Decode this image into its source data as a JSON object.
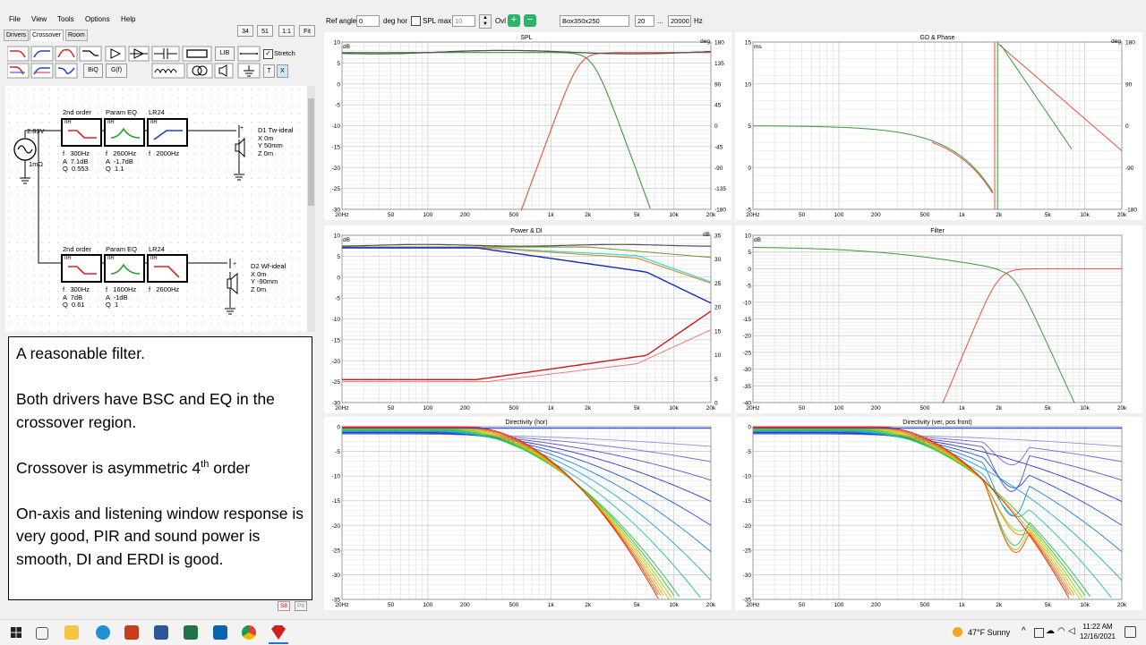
{
  "menu": [
    "File",
    "View",
    "Tools",
    "Options",
    "Help"
  ],
  "tabs": [
    "Drivers",
    "Crossover",
    "Room"
  ],
  "toolbar": {
    "buttons": [
      "34",
      "51",
      "1:1",
      "Fit"
    ],
    "biq": "BiQ",
    "gf": "G(f)",
    "lib": "LIB",
    "stretch_label": "Stretch",
    "stretch_checked": true,
    "t": "T",
    "x": "X"
  },
  "schematic": {
    "source_voltage": "2.83V",
    "source_impedance": "1mΩ",
    "row1": {
      "headers": [
        "2nd order",
        "Param EQ",
        "LR24"
      ],
      "blocks": [
        {
          "type": "IIR",
          "params": "f   300Hz\nA  7.1dB\nQ  0.553"
        },
        {
          "type": "IIR",
          "params": "f   2600Hz\nA  -1.7dB\nQ  1.1"
        },
        {
          "type": "IIR",
          "params": "f   2000Hz"
        }
      ],
      "driver": "D1 Tw-ideal\nX 0m\nY 50mm\nZ 0m"
    },
    "row2": {
      "headers": [
        "2nd order",
        "Param EQ",
        "LR24"
      ],
      "blocks": [
        {
          "type": "IIR",
          "params": "f   300Hz\nA  7dB\nQ  0.61"
        },
        {
          "type": "IIR",
          "params": "f   1600Hz\nA  -1dB\nQ  1"
        },
        {
          "type": "IIR",
          "params": "f   2600Hz"
        }
      ],
      "driver": "D2 Wf-ideal\nX 0m\nY -90mm\nZ 0m"
    },
    "plus": "+",
    "minus": "-"
  },
  "notes": {
    "p1": "A reasonable filter.",
    "p2": "Both drivers have BSC and EQ in the crossover region.",
    "p3_pre": "Crossover is asymmetric 4",
    "p3_sup": "th",
    "p3_post": " order",
    "p4": "On-axis and listening window response is very good, PIR and sound power is smooth, DI and ERDI is good."
  },
  "status_buttons": [
    "S8",
    "P8"
  ],
  "graph_bar": {
    "ref_angle_label": "Ref angle",
    "ref_angle_value": "0",
    "deg_hor": "deg hor",
    "spl_max_label": "SPL max",
    "spl_max_value": "10",
    "ovl_label": "Ovl",
    "baffle": "Box350x250",
    "f_low": "20",
    "dots": "...",
    "f_high": "20000",
    "hz": "Hz"
  },
  "x_ticks": [
    "20Hz",
    "50",
    "100",
    "200",
    "500",
    "1k",
    "2k",
    "5k",
    "10k",
    "20k"
  ],
  "x_tick_freqs": [
    20,
    50,
    100,
    200,
    500,
    1000,
    2000,
    5000,
    10000,
    20000
  ],
  "plots": [
    {
      "id": "spl",
      "title": "SPL",
      "unit_left": "dB",
      "unit_right": "deg",
      "y_left": [
        "10",
        "5",
        "0",
        "-5",
        "-10",
        "-15",
        "-20",
        "-25",
        "-30"
      ],
      "y_right": [
        "180",
        "135",
        "90",
        "45",
        "0",
        "-45",
        "-90",
        "-135",
        "-180"
      ]
    },
    {
      "id": "gd",
      "title": "GD & Phase",
      "unit_left": "ms",
      "unit_right": "deg",
      "y_left": [
        "15",
        "10",
        "5",
        "0",
        "-5"
      ],
      "y_right": [
        "180",
        "90",
        "0",
        "-90",
        "-180"
      ]
    },
    {
      "id": "power",
      "title": "Power & DI",
      "unit_left": "dB",
      "unit_right": "dB",
      "y_left": [
        "10",
        "5",
        "0",
        "-5",
        "-10",
        "-15",
        "-20",
        "-25",
        "-30"
      ],
      "y_right": [
        "35",
        "30",
        "25",
        "20",
        "15",
        "10",
        "5",
        "0"
      ]
    },
    {
      "id": "filter",
      "title": "Filter",
      "unit_left": "dB",
      "unit_right": "",
      "y_left": [
        "10",
        "5",
        "0",
        "-5",
        "-10",
        "-15",
        "-20",
        "-25",
        "-30",
        "-35",
        "-40"
      ],
      "y_right": []
    },
    {
      "id": "dirh",
      "title": "Directivity (hor)",
      "unit_left": "dB",
      "unit_right": "",
      "y_left": [
        "0",
        "-5",
        "-10",
        "-15",
        "-20",
        "-25",
        "-30",
        "-35"
      ],
      "y_right": []
    },
    {
      "id": "dirv",
      "title": "Directivity (ver, pos front)",
      "unit_left": "dB",
      "unit_right": "",
      "y_left": [
        "0",
        "-5",
        "-10",
        "-15",
        "-20",
        "-25",
        "-30",
        "-35"
      ],
      "y_right": []
    }
  ],
  "taskbar": {
    "weather": "47°F  Sunny",
    "time": "11:22 AM",
    "date": "12/16/2021"
  },
  "colors": {
    "woofer": "#3a9a3a",
    "tweeter": "#e8503a",
    "sum": "#505050",
    "blue": "#1428c8",
    "cyan": "#30d8e0",
    "orange": "#d89030"
  }
}
